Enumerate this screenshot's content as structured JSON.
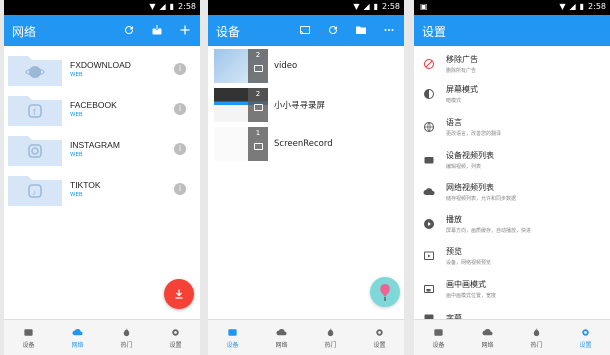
{
  "status": {
    "time": "2:58"
  },
  "screen1": {
    "title": "网络",
    "folders": [
      {
        "name": "FXDOWNLOAD",
        "sub": "WEB"
      },
      {
        "name": "FACEBOOK",
        "sub": "WEB"
      },
      {
        "name": "INSTAGRAM",
        "sub": "WEB"
      },
      {
        "name": "TIKTOK",
        "sub": "WEB"
      }
    ],
    "nav": [
      "设备",
      "网络",
      "热门",
      "设置"
    ]
  },
  "screen2": {
    "title": "设备",
    "videos": [
      {
        "name": "video",
        "count": "2"
      },
      {
        "name": "小小寻寻录屏",
        "count": "2"
      },
      {
        "name": "ScreenRecord",
        "count": "1"
      }
    ],
    "nav": [
      "设备",
      "网络",
      "热门",
      "设置"
    ]
  },
  "screen3": {
    "title": "设置",
    "items": [
      {
        "t1": "移除广告",
        "t2": "删除所有广告"
      },
      {
        "t1": "屏幕模式",
        "t2": "暗模式"
      },
      {
        "t1": "语言",
        "t2": "更改语言，改善您的翻译"
      },
      {
        "t1": "设备视频列表",
        "t2": "编辑视频，列表"
      },
      {
        "t1": "网络视频列表",
        "t2": "储存视频列表，允许和同步数据"
      },
      {
        "t1": "播放",
        "t2": "屏幕方向，画质缓存，自动播放，快进"
      },
      {
        "t1": "预览",
        "t2": "设备，网络视频预览"
      },
      {
        "t1": "画中画模式",
        "t2": "画中画模式位置，宽度"
      },
      {
        "t1": "字幕",
        "t2": ""
      }
    ],
    "nav": [
      "设备",
      "网络",
      "热门",
      "设置"
    ]
  },
  "colors": {
    "primary": "#2196f3",
    "fab": "#f44336",
    "folder": "#d6e6f7"
  }
}
